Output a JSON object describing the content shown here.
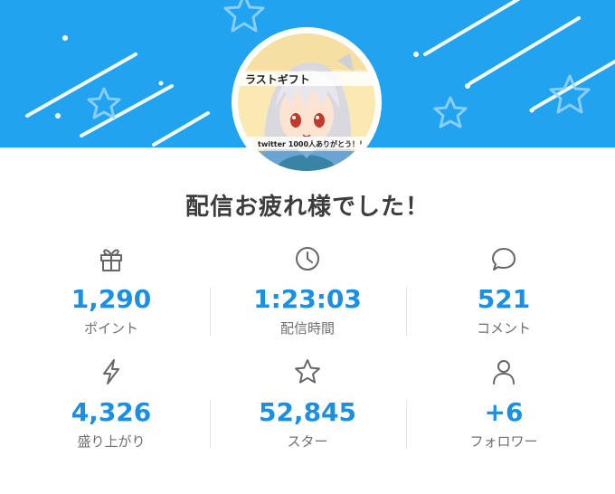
{
  "header": {
    "banner_color": "#21a3ef",
    "avatar_caption": "twitter 1000人ありがとう！！",
    "avatar_banner_text": "ラストギフト"
  },
  "title": "配信お疲れ様でした！",
  "stats": [
    {
      "icon": "gift-icon",
      "value": "1,290",
      "label": "ポイント"
    },
    {
      "icon": "clock-icon",
      "value": "1:23:03",
      "label": "配信時間"
    },
    {
      "icon": "comment-icon",
      "value": "521",
      "label": "コメント"
    },
    {
      "icon": "lightning-icon",
      "value": "4,326",
      "label": "盛り上がり"
    },
    {
      "icon": "star-icon",
      "value": "52,845",
      "label": "スター"
    },
    {
      "icon": "person-icon",
      "value": "+6",
      "label": "フォロワー"
    }
  ],
  "colors": {
    "accent": "#1a8fe3",
    "label": "#6f6f6f",
    "title": "#3d3d3d"
  }
}
